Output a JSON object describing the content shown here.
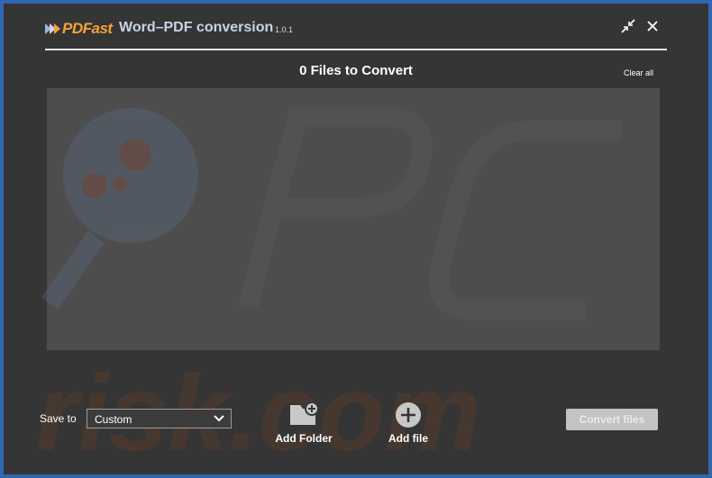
{
  "header": {
    "logo_text": "PDFast",
    "app_title": "Word–PDF conversion",
    "version": "1.0.1",
    "minimize_icon": "collapse-arrows-icon",
    "close_icon": "close-icon"
  },
  "main": {
    "files_title": "0 Files to Convert",
    "clear_all_label": "Clear all"
  },
  "footer": {
    "save_to_label": "Save to",
    "save_to_value": "Custom",
    "add_folder_label": "Add Folder",
    "add_file_label": "Add file",
    "convert_label": "Convert files"
  },
  "watermark_text": "risk.com",
  "colors": {
    "frame_border": "#2f67b0",
    "background": "#353535",
    "drop_area": "#4d4d4d",
    "logo_accent": "#f2a23a",
    "title_text": "#c9d3e6",
    "convert_button_disabled": "#c3c3c3"
  }
}
